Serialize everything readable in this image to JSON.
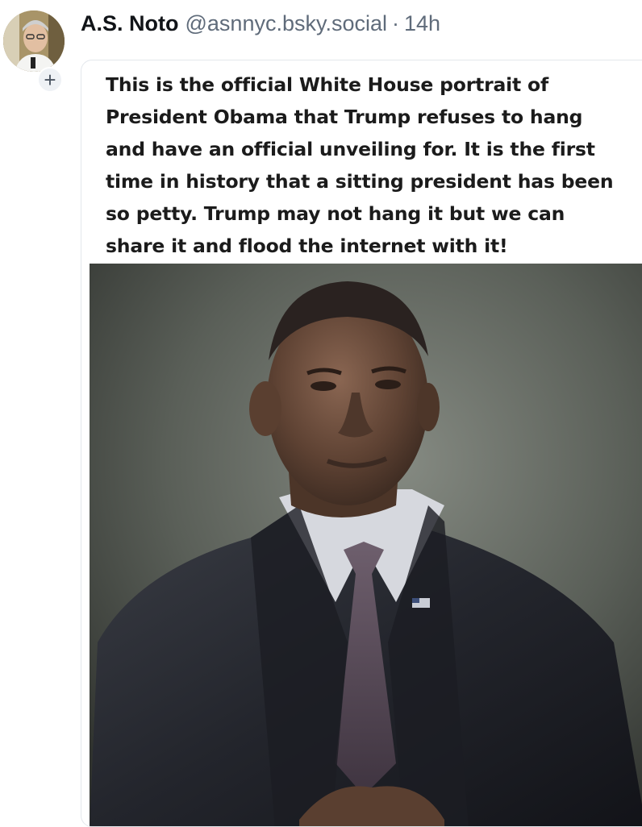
{
  "post": {
    "author_name": "A.S. Noto",
    "handle": "@asnnyc.bsky.social",
    "separator": "·",
    "time": "14h",
    "follow_glyph": "+"
  },
  "embed": {
    "lines": [
      "This is the official White House portrait of",
      "President Obama that Trump refuses to hang",
      "and have an official unveiling for. It is the first",
      "time in history that a sitting president has been",
      "so petty. Trump may not hang it but we can",
      "share it and flood the internet with it!"
    ]
  },
  "icons": {
    "follow": "plus-icon"
  },
  "colors": {
    "name": "#111418",
    "meta": "#5f6b7a",
    "embed_border": "#e3e7ec",
    "follow_bg": "#eef1f5"
  }
}
